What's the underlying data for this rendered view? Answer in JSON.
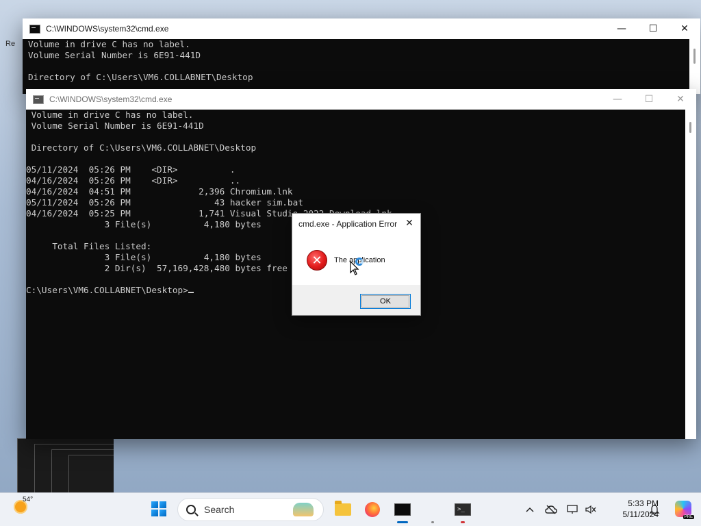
{
  "desktop": {
    "left_label": "Re"
  },
  "back_window": {
    "title": "C:\\WINDOWS\\system32\\cmd.exe",
    "lines": [
      "Volume in drive C has no label.",
      "Volume Serial Number is 6E91-441D",
      "",
      "Directory of C:\\Users\\VM6.COLLABNET\\Desktop"
    ]
  },
  "front_window": {
    "title": "C:\\WINDOWS\\system32\\cmd.exe",
    "lines": [
      " Volume in drive C has no label.",
      " Volume Serial Number is 6E91-441D",
      "",
      " Directory of C:\\Users\\VM6.COLLABNET\\Desktop",
      "",
      "05/11/2024  05:26 PM    <DIR>          .",
      "04/16/2024  05:26 PM    <DIR>          ..",
      "04/16/2024  04:51 PM             2,396 Chromium.lnk",
      "05/11/2024  05:26 PM                43 hacker sim.bat",
      "04/16/2024  05:25 PM             1,741 Visual Studio 2022 Download.lnk",
      "               3 File(s)          4,180 bytes",
      "",
      "     Total Files Listed:",
      "               3 File(s)          4,180 bytes",
      "               2 Dir(s)  57,169,428,480 bytes free",
      ""
    ],
    "prompt": "C:\\Users\\VM6.COLLABNET\\Desktop>"
  },
  "window_controls": {
    "minimize": "—",
    "maximize": "☐",
    "close": "✕"
  },
  "dialog": {
    "title": "cmd.exe - Application Error",
    "close_glyph": "✕",
    "message": "The application",
    "error_glyph": "✕",
    "ok_label": "OK"
  },
  "taskbar": {
    "weather_temp": "54°",
    "search_placeholder": "Search",
    "terminal_glyph": ">_",
    "time": "5:33 PM",
    "date": "5/11/2024",
    "copilot_badge": "PRE"
  },
  "colors": {
    "console_bg": "#0c0c0c",
    "console_fg": "#cccccc",
    "accent": "#0078d7",
    "error_red": "#e21b1b"
  }
}
